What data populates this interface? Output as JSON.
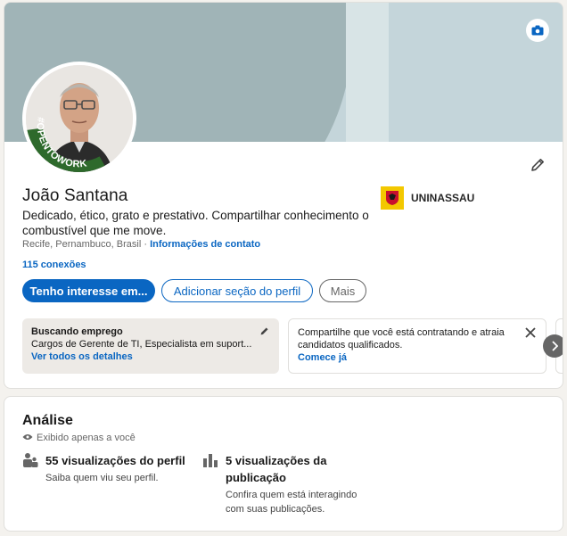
{
  "profile": {
    "name": "João Santana",
    "headline": "Dedicado, ético, grato e prestativo. Compartilhar conhecimento o combustível que me move.",
    "location": "Recife, Pernambuco, Brasil ·",
    "contact_info_link": "Informações de contato",
    "connections": "115 conexões",
    "avatar_frame_text": "#OPENTOWORK",
    "education": {
      "name": "UNINASSAU",
      "logo_color": "#f3c800"
    }
  },
  "actions": {
    "primary": "Tenho interesse em...",
    "add_section": "Adicionar seção do perfil",
    "more": "Mais"
  },
  "open_to_work": {
    "title": "Buscando emprego",
    "roles": "Cargos de Gerente de TI, Especialista em suport...",
    "link": "Ver todos os detalhes"
  },
  "hiring": {
    "text": "Compartilhe que você está contratando e atraia candidatos qualificados.",
    "link": "Comece já"
  },
  "analytics": {
    "title": "Análise",
    "private_note": "Exibido apenas a você",
    "metrics": [
      {
        "title": "55 visualizações do perfil",
        "subtitle": "Saiba quem viu seu perfil.",
        "icon": "people-icon"
      },
      {
        "title": "5 visualizações da publicação",
        "subtitle": "Confira quem está interagindo com suas publicações.",
        "icon": "bar-chart-icon"
      }
    ]
  },
  "colors": {
    "accent": "#0a66c2",
    "opentowork_green": "#2e6a2c",
    "banner": "#a0b4b7"
  }
}
